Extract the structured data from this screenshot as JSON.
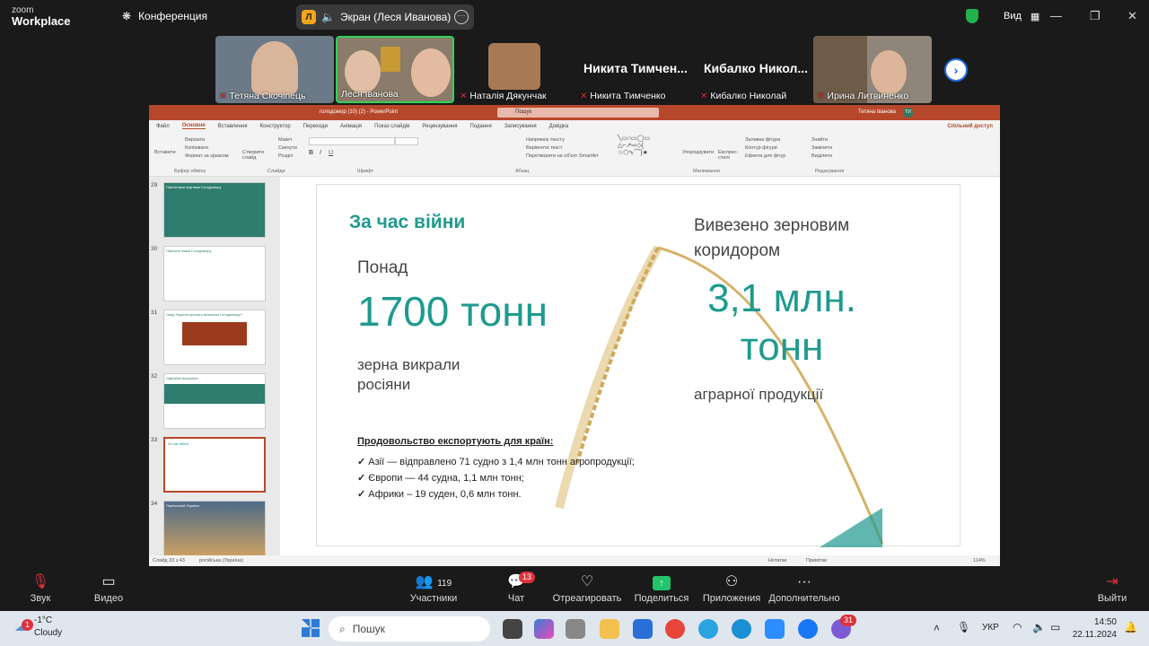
{
  "zoom_logo": {
    "top": "zoom",
    "bottom": "Workplace"
  },
  "topbar": {
    "conference": "Конференция",
    "share_owner_initial": "Л",
    "screen_label": "Экран (Леся Иванова)",
    "view": "Вид"
  },
  "participants": [
    {
      "name": "Тетяна Скочіпець",
      "muted": true
    },
    {
      "name": "Леся Іванова",
      "muted": false
    },
    {
      "name": "Наталія Дякунчак",
      "muted": true
    },
    {
      "big": "Никита Тимчен...",
      "name": "Никита Тимченко",
      "muted": true
    },
    {
      "big": "Кибалко Никол...",
      "name": "Кибалко Николай",
      "muted": true
    },
    {
      "name": "Ирина Литвиненко",
      "muted": true
    }
  ],
  "ppt": {
    "title": "голодомор (10) (2) - PowerPoint",
    "search": "Пошук",
    "user": "Тетяна Іванова",
    "user_initials": "ТИ",
    "menu": [
      "Файл",
      "Основне",
      "Вставлення",
      "Конструктор",
      "Переходи",
      "Анімація",
      "Показ слайдів",
      "Рецензування",
      "Подання",
      "Записування",
      "Довідка"
    ],
    "share": "Спільний доступ",
    "ribbon_groups": [
      "Буфер обміну",
      "Слайди",
      "Шрифт",
      "Абзац",
      "Малювання",
      "Редагування"
    ],
    "ribbon_items": {
      "insert": "Вставити",
      "cut": "Вирізати",
      "copy": "Копіювати",
      "format": "Формат за зразком",
      "new_slide": "Створити слайд",
      "layout": "Макет",
      "reset": "Скинути",
      "section": "Розділ",
      "text_dir": "Напрямок тексту",
      "align_text": "Вирівняти текст",
      "smartart": "Перетворити на об'єкт SmartArt",
      "arrange": "Упорядкувати",
      "quick_styles": "Експрес-стилі",
      "fill": "Заливка фігури",
      "outline": "Контур фігури",
      "effects": "Ефекти для фігур",
      "find": "Знайти",
      "replace": "Замінити",
      "select": "Виділити"
    },
    "thumbnails": [
      {
        "num": "29",
        "title": "Пам'ятники жертвам Голодомору"
      },
      {
        "num": "30",
        "title": "Пам'ятні знаки Голодомору"
      },
      {
        "num": "31",
        "title": "Чому Україна просить визнання Голодомору?"
      },
      {
        "num": "32",
        "title": "Офіційне визнання"
      },
      {
        "num": "33",
        "title": "За час війни"
      },
      {
        "num": "34",
        "title": "Пшеничний Україна"
      }
    ],
    "status": {
      "slide": "Слайд 33 з 43",
      "lang": "російська (Україна)",
      "notes": "Нотатки",
      "comments": "Примітки",
      "zoom": "114%"
    }
  },
  "slide": {
    "heading": "За час війни",
    "ponad": "Понад",
    "big_number": "1700 тонн",
    "grain": "зерна викрали росіяни",
    "right_heading": "Вивезено зерновим коридором",
    "right_number": "3,1 млн. тонн",
    "right_sub": "аграрної продукції",
    "export_title": "Продовольство експортують для країн:",
    "export_list": [
      "Азії — відправлено 71 судно з 1,4 млн тонн агропродукції;",
      "Європи — 44 судна, 1,1 млн тонн;",
      "Африки – 19 суден, 0,6 млн тонн."
    ]
  },
  "toolbar": {
    "audio": "Звук",
    "video": "Видео",
    "participants": "Участники",
    "participants_count": "119",
    "chat": "Чат",
    "chat_badge": "13",
    "react": "Отреагировать",
    "share": "Поделиться",
    "apps": "Приложения",
    "more": "Дополнительно",
    "leave": "Выйти"
  },
  "taskbar": {
    "temp": "-1°C",
    "weather": "Cloudy",
    "weather_badge": "1",
    "search": "Пошук",
    "lang": "УКР",
    "time": "14:50",
    "date": "22.11.2024",
    "viber_badge": "31"
  }
}
